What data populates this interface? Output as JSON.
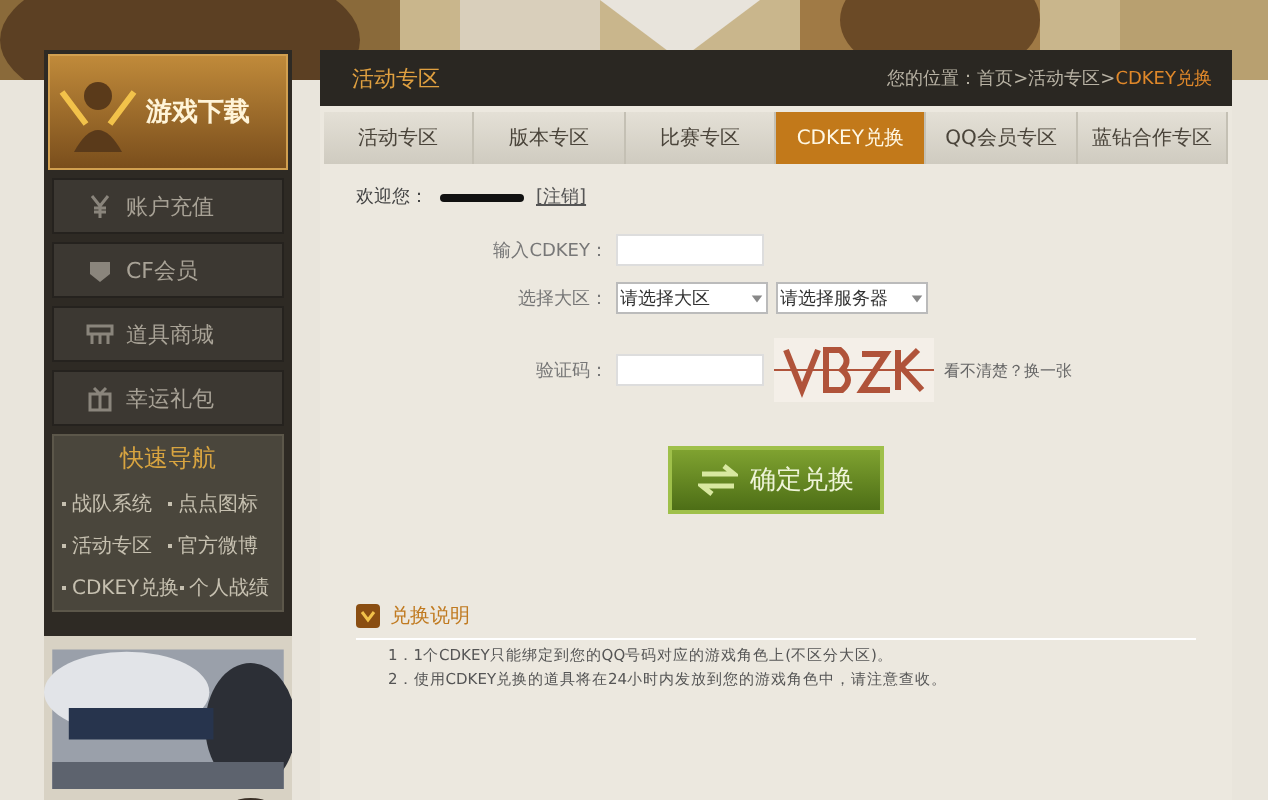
{
  "sidebar": {
    "download_banner": {
      "title": "游戏下载"
    },
    "menu": [
      {
        "label": "账户充值"
      },
      {
        "label": "CF会员"
      },
      {
        "label": "道具商城"
      },
      {
        "label": "幸运礼包"
      }
    ],
    "quick_nav": {
      "title": "快速导航",
      "links": [
        "战队系统",
        "点点图标",
        "活动专区",
        "官方微博",
        "CDKEY兑换",
        "个人战绩"
      ]
    }
  },
  "header": {
    "title": "活动专区",
    "breadcrumb": [
      "您的位置：首页",
      "活动专区",
      "CDKEY兑换"
    ],
    "separator": ">"
  },
  "tabs": [
    {
      "label": "活动专区",
      "selected": false
    },
    {
      "label": "版本专区",
      "selected": false
    },
    {
      "label": "比赛专区",
      "selected": false
    },
    {
      "label": "CDKEY兑换",
      "selected": true
    },
    {
      "label": "QQ会员专区",
      "selected": false
    },
    {
      "label": "蓝钻合作专区",
      "selected": false
    }
  ],
  "welcome": {
    "label": "欢迎您：",
    "logout": "[注销]"
  },
  "form": {
    "cdkey_label": "输入CDKEY：",
    "region_label": "选择大区：",
    "region_select": "请选择大区",
    "server_select": "请选择服务器",
    "captcha_label": "验证码：",
    "refresh_link": "看不清楚？换一张"
  },
  "submit": {
    "label": "确定兑换"
  },
  "notes": {
    "title": "兑换说明",
    "items": [
      "1．1个CDKEY只能绑定到您的QQ号码对应的游戏角色上(不区分大区)。",
      "2．使用CDKEY兑换的道具将在24小时内发放到您的游戏角色中，请注意查收。"
    ]
  }
}
